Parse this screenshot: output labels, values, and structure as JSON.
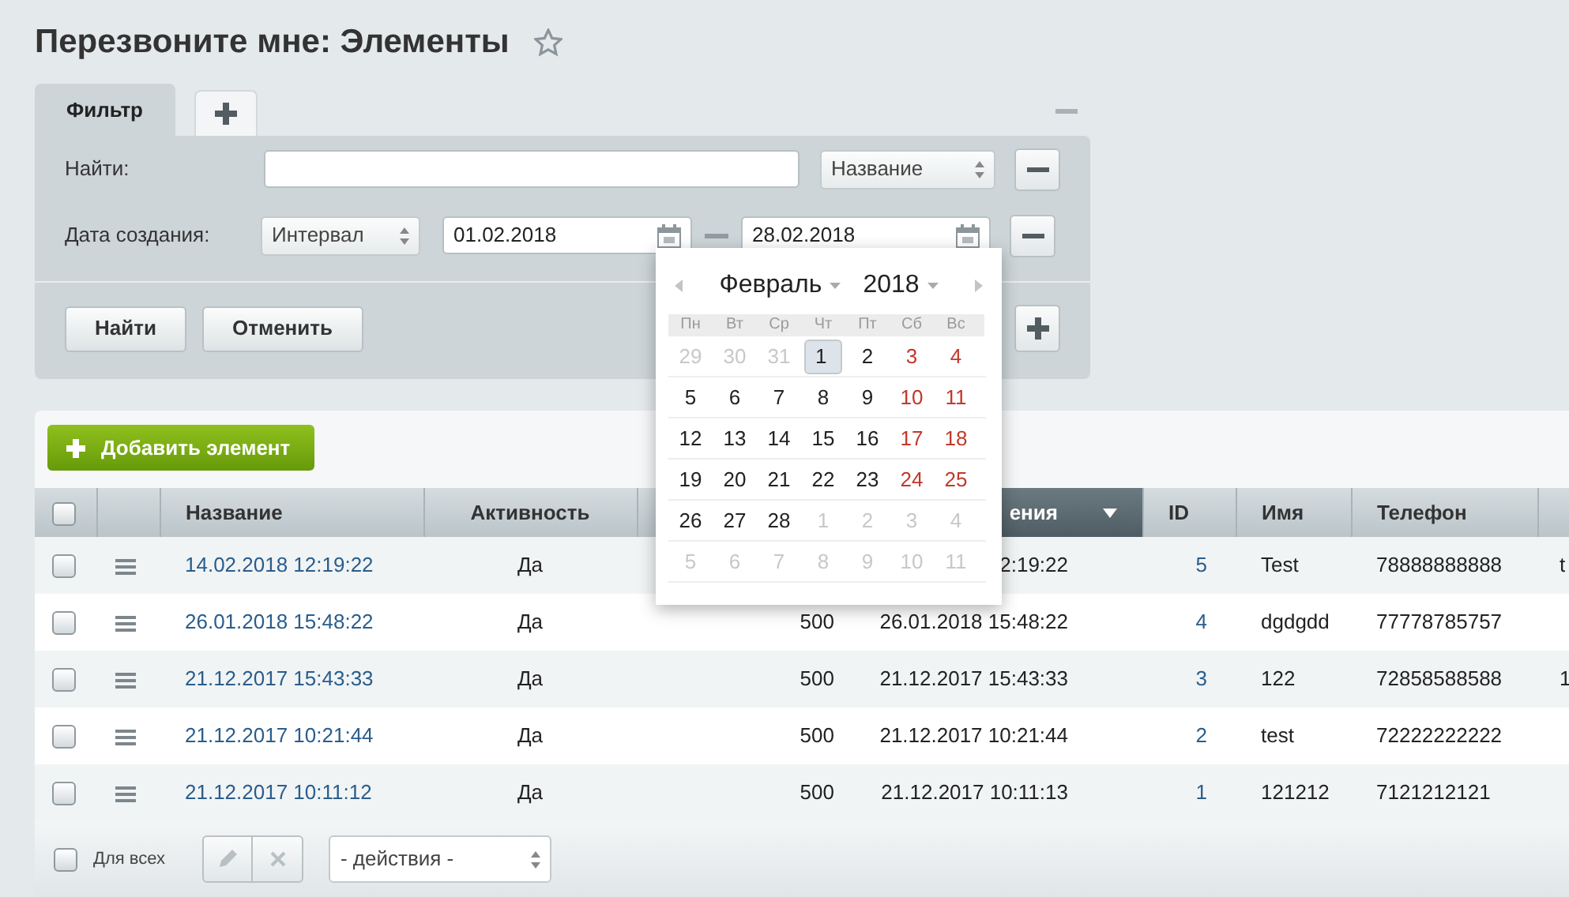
{
  "page": {
    "title": "Перезвоните мне: Элементы"
  },
  "filter": {
    "tabs": [
      {
        "label": "Фильтр",
        "selected": true
      }
    ],
    "rows": [
      {
        "kind": "search",
        "label": "Найти:",
        "select": "Название"
      },
      {
        "kind": "date_range",
        "label": "Дата создания:",
        "select": "Интервал",
        "from": "01.02.2018",
        "to": "28.02.2018"
      }
    ],
    "buttons": [
      "Найти",
      "Отменить"
    ]
  },
  "calendar": {
    "month": "Февраль",
    "year": "2018",
    "weekdays": [
      "Пн",
      "Вт",
      "Ср",
      "Чт",
      "Пт",
      "Сб",
      "Вс"
    ],
    "weeks": [
      [
        {
          "day": "29",
          "other_month": true,
          "selected": false
        },
        {
          "day": "30",
          "other_month": true,
          "selected": false
        },
        {
          "day": "31",
          "other_month": true,
          "selected": false
        },
        {
          "day": "1",
          "other_month": false,
          "weekend": false,
          "selected": true
        },
        {
          "day": "2",
          "other_month": false,
          "weekend": false,
          "selected": false
        },
        {
          "day": "3",
          "other_month": false,
          "weekend": true,
          "selected": false
        },
        {
          "day": "4",
          "other_month": false,
          "weekend": true,
          "selected": false
        }
      ],
      [
        {
          "day": "5",
          "other_month": false,
          "weekend": false,
          "selected": false
        },
        {
          "day": "6",
          "other_month": false,
          "weekend": false,
          "selected": false
        },
        {
          "day": "7",
          "other_month": false,
          "weekend": false,
          "selected": false
        },
        {
          "day": "8",
          "other_month": false,
          "weekend": false,
          "selected": false
        },
        {
          "day": "9",
          "other_month": false,
          "weekend": false,
          "selected": false
        },
        {
          "day": "10",
          "other_month": false,
          "weekend": true,
          "selected": false
        },
        {
          "day": "11",
          "other_month": false,
          "weekend": true,
          "selected": false
        }
      ],
      [
        {
          "day": "12",
          "other_month": false,
          "weekend": false,
          "selected": false
        },
        {
          "day": "13",
          "other_month": false,
          "weekend": false,
          "selected": false
        },
        {
          "day": "14",
          "other_month": false,
          "weekend": false,
          "selected": false
        },
        {
          "day": "15",
          "other_month": false,
          "weekend": false,
          "selected": false
        },
        {
          "day": "16",
          "other_month": false,
          "weekend": false,
          "selected": false
        },
        {
          "day": "17",
          "other_month": false,
          "weekend": true,
          "selected": false
        },
        {
          "day": "18",
          "other_month": false,
          "weekend": true,
          "selected": false
        }
      ],
      [
        {
          "day": "19",
          "other_month": false,
          "weekend": false,
          "selected": false
        },
        {
          "day": "20",
          "other_month": false,
          "weekend": false,
          "selected": false
        },
        {
          "day": "21",
          "other_month": false,
          "weekend": false,
          "selected": false
        },
        {
          "day": "22",
          "other_month": false,
          "weekend": false,
          "selected": false
        },
        {
          "day": "23",
          "other_month": false,
          "weekend": false,
          "selected": false
        },
        {
          "day": "24",
          "other_month": false,
          "weekend": true,
          "selected": false
        },
        {
          "day": "25",
          "other_month": false,
          "weekend": true,
          "selected": false
        }
      ],
      [
        {
          "day": "26",
          "other_month": false,
          "weekend": false,
          "selected": false
        },
        {
          "day": "27",
          "other_month": false,
          "weekend": false,
          "selected": false
        },
        {
          "day": "28",
          "other_month": false,
          "weekend": false,
          "selected": false
        },
        {
          "day": "1",
          "other_month": true,
          "selected": false
        },
        {
          "day": "2",
          "other_month": true,
          "selected": false
        },
        {
          "day": "3",
          "other_month": true,
          "selected": false
        },
        {
          "day": "4",
          "other_month": true,
          "selected": false
        }
      ],
      [
        {
          "day": "5",
          "other_month": true,
          "selected": false
        },
        {
          "day": "6",
          "other_month": true,
          "selected": false
        },
        {
          "day": "7",
          "other_month": true,
          "selected": false
        },
        {
          "day": "8",
          "other_month": true,
          "selected": false
        },
        {
          "day": "9",
          "other_month": true,
          "selected": false
        },
        {
          "day": "10",
          "other_month": true,
          "selected": false
        },
        {
          "day": "11",
          "other_month": true,
          "selected": false
        }
      ]
    ]
  },
  "toolbar": {
    "add_button": "Добавить элемент"
  },
  "table": {
    "header_checked": false,
    "columns": [
      {
        "kind": "check"
      },
      {
        "kind": "menu"
      },
      {
        "kind": "link",
        "label": "Название",
        "sorted": false
      },
      {
        "kind": "center",
        "label": "Активность",
        "sorted": false
      },
      {
        "kind": "number"
      },
      {
        "kind": "date",
        "label": "ения",
        "sorted": true
      },
      {
        "kind": "id",
        "label": "ID",
        "sorted": false
      },
      {
        "kind": "text",
        "label": "Имя",
        "sorted": false
      },
      {
        "kind": "text",
        "label": "Телефон",
        "sorted": false
      },
      {
        "kind": "edge"
      }
    ],
    "rows": [
      {
        "checked": false,
        "cells": [
          "",
          "",
          "14.02.2018 12:19:22",
          "Да",
          null,
          "2:19:22",
          "5",
          "Test",
          "78888888888",
          "t"
        ]
      },
      {
        "checked": false,
        "cells": [
          "",
          "",
          "26.01.2018 15:48:22",
          "Да",
          "500",
          "26.01.2018 15:48:22",
          "4",
          "dgdgdd",
          "77778785757",
          null
        ]
      },
      {
        "checked": false,
        "cells": [
          "",
          "",
          "21.12.2017 15:43:33",
          "Да",
          "500",
          "21.12.2017 15:43:33",
          "3",
          "122",
          "72858588588",
          "1"
        ]
      },
      {
        "checked": false,
        "cells": [
          "",
          "",
          "21.12.2017 10:21:44",
          "Да",
          "500",
          "21.12.2017 10:21:44",
          "2",
          "test",
          "72222222222",
          null
        ]
      },
      {
        "checked": false,
        "cells": [
          "",
          "",
          "21.12.2017 10:11:12",
          "Да",
          "500",
          "21.12.2017 10:11:13",
          "1",
          "121212",
          "7121212121",
          null
        ]
      }
    ]
  },
  "footer": {
    "checked": false,
    "label": "Для всех",
    "actions_select": "- действия -"
  }
}
